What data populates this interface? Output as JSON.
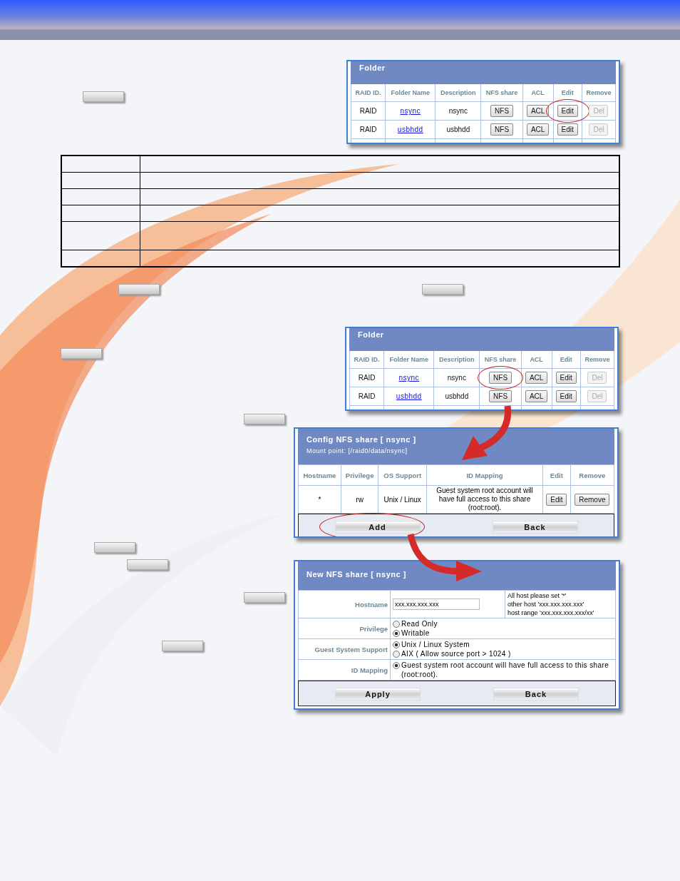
{
  "folder_panels": [
    {
      "title": "Folder",
      "columns": [
        "RAID ID.",
        "Folder Name",
        "Description",
        "NFS share",
        "ACL",
        "Edit",
        "Remove"
      ],
      "rows": [
        {
          "raid_id": "RAID",
          "folder_name": "nsync",
          "description": "nsync",
          "buttons": [
            {
              "label": "NFS",
              "disabled": false,
              "circled": false
            },
            {
              "label": "ACL",
              "disabled": false,
              "circled": false
            },
            {
              "label": "Edit",
              "disabled": false,
              "circled": true
            },
            {
              "label": "Del",
              "disabled": true,
              "circled": false
            }
          ]
        },
        {
          "raid_id": "RAID",
          "folder_name": "usbhdd",
          "description": "usbhdd",
          "buttons": [
            {
              "label": "NFS",
              "disabled": false,
              "circled": false
            },
            {
              "label": "ACL",
              "disabled": false,
              "circled": false
            },
            {
              "label": "Edit",
              "disabled": false,
              "circled": false
            },
            {
              "label": "Del",
              "disabled": true,
              "circled": false
            }
          ]
        }
      ]
    },
    {
      "title": "Folder",
      "columns": [
        "RAID ID.",
        "Folder Name",
        "Description",
        "NFS share",
        "ACL",
        "Edit",
        "Remove"
      ],
      "rows": [
        {
          "raid_id": "RAID",
          "folder_name": "nsync",
          "description": "nsync",
          "buttons": [
            {
              "label": "NFS",
              "disabled": false,
              "circled": true
            },
            {
              "label": "ACL",
              "disabled": false,
              "circled": false
            },
            {
              "label": "Edit",
              "disabled": false,
              "circled": false
            },
            {
              "label": "Del",
              "disabled": true,
              "circled": false
            }
          ]
        },
        {
          "raid_id": "RAID",
          "folder_name": "usbhdd",
          "description": "usbhdd",
          "buttons": [
            {
              "label": "NFS",
              "disabled": false,
              "circled": false
            },
            {
              "label": "ACL",
              "disabled": false,
              "circled": false
            },
            {
              "label": "Edit",
              "disabled": false,
              "circled": false
            },
            {
              "label": "Del",
              "disabled": true,
              "circled": false
            }
          ]
        }
      ]
    }
  ],
  "config_panel": {
    "title": "Config NFS share [ nsync ]",
    "mount_point": "Mount point: [/raid0/data/nsync]",
    "columns": [
      "Hostname",
      "Privilege",
      "OS Support",
      "ID Mapping",
      "Edit",
      "Remove"
    ],
    "rows": [
      {
        "hostname": "*",
        "privilege": "rw",
        "os_support": "Unix / Linux",
        "id_mapping": "Guest system root account will have full access to this share (root:root).",
        "buttons": [
          {
            "label": "Edit"
          },
          {
            "label": "Remove"
          }
        ]
      }
    ],
    "footer_buttons": [
      {
        "label": "Add",
        "circled": true
      },
      {
        "label": "Back",
        "circled": false
      }
    ]
  },
  "new_panel": {
    "title": "New NFS share [ nsync ]",
    "hostname": {
      "label": "Hostname",
      "value": "xxx.xxx.xxx.xxx",
      "hint_lines": [
        "All host please set '*'",
        "other host 'xxx.xxx.xxx.xxx'",
        "host range 'xxx.xxx.xxx.xxx/xx'"
      ]
    },
    "option_groups": [
      {
        "label": "Privilege",
        "options": [
          {
            "label": "Read Only",
            "selected": false
          },
          {
            "label": "Writable",
            "selected": true
          }
        ]
      },
      {
        "label": "Guest System Support",
        "options": [
          {
            "label": "Unix / Linux System",
            "selected": true
          },
          {
            "label": "AIX ( Allow source port > 1024 )",
            "selected": false
          }
        ]
      },
      {
        "label": "ID Mapping",
        "options": [
          {
            "label": "Guest system root account will have full access to this share (root:root).",
            "selected": true
          }
        ]
      }
    ],
    "footer_buttons": [
      {
        "label": "Apply",
        "circled": false
      },
      {
        "label": "Back",
        "circled": false
      }
    ]
  }
}
